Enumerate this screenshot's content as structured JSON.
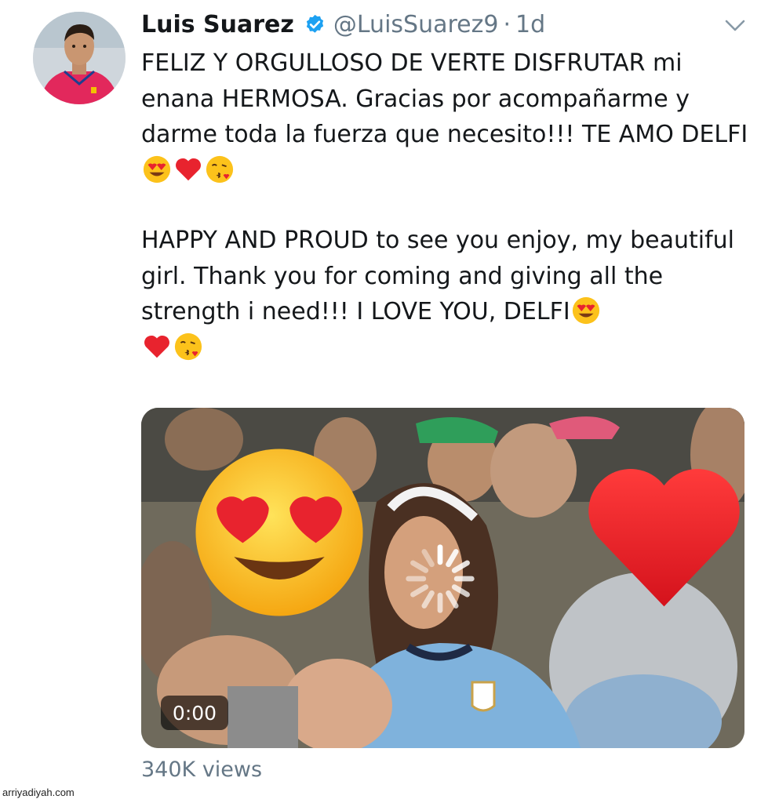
{
  "tweet": {
    "author_name": "Luis Suarez",
    "handle": "@LuisSuarez9",
    "separator": "·",
    "time": "1d",
    "verified_icon": "verified-badge-icon",
    "menu_icon": "chevron-down-icon",
    "text_es": "FELIZ Y ORGULLOSO DE VERTE DISFRUTAR mi enana HERMOSA. Gracias por acompañarme y darme toda la fuerza que necesito!!! TE AMO DELFI",
    "text_en_line1": "HAPPY AND PROUD to see you enjoy, my beautiful girl. Thank you for coming and giving all the strength i need!!! I LOVE YOU, DELFI",
    "emoji_sequence": [
      "heart-eyes-emoji",
      "red-heart-emoji",
      "kissing-face-emoji"
    ]
  },
  "media": {
    "type": "video",
    "duration": "0:00",
    "overlay_icons": [
      "heart-eyes-emoji",
      "red-heart-emoji",
      "loading-spinner-icon"
    ]
  },
  "stats": {
    "views": "340K views"
  },
  "watermark": "arriyadiyah.com",
  "colors": {
    "text_primary": "#14171a",
    "text_secondary": "#657786",
    "verified_blue": "#1da1f2"
  }
}
